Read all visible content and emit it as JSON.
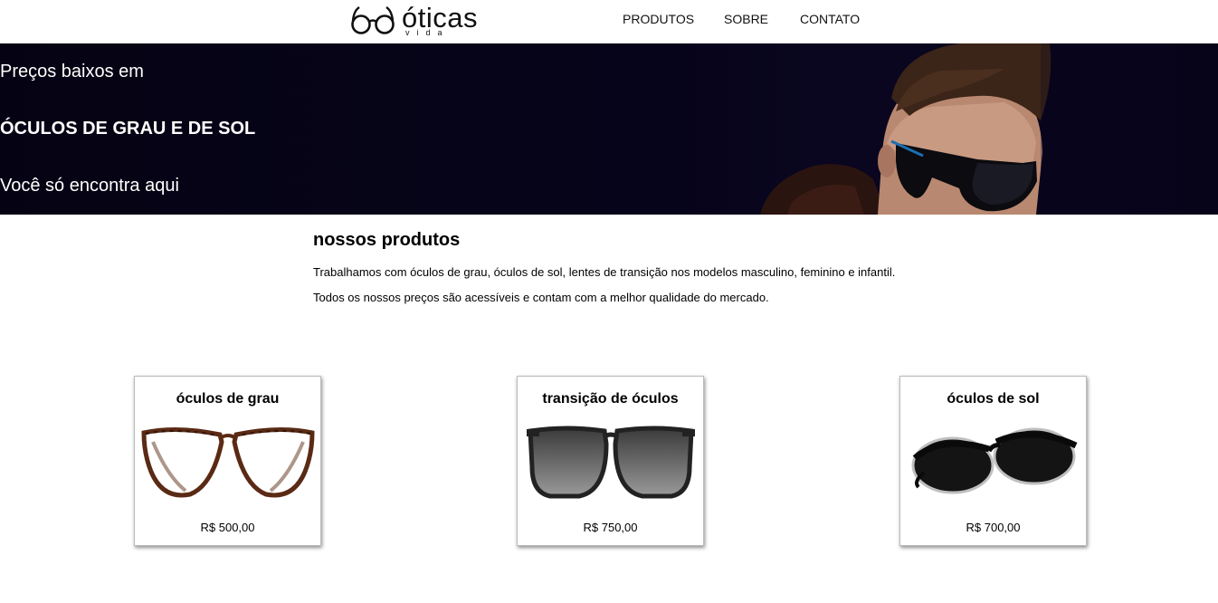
{
  "brand": {
    "name": "óticas",
    "sub": "vida"
  },
  "nav": {
    "items": [
      "PRODUTOS",
      "SOBRE",
      "CONTATO"
    ]
  },
  "hero": {
    "line1": "Preços baixos em",
    "line2": "ÓCULOS DE GRAU E DE SOL",
    "line3": "Você só encontra aqui"
  },
  "products_section": {
    "title": "nossos produtos",
    "paragraph1": "Trabalhamos com óculos de grau, óculos de sol, lentes de transição nos modelos masculino, feminino e infantil.",
    "paragraph2": "Todos os nossos preços são acessíveis e contam com a melhor qualidade do mercado."
  },
  "products": [
    {
      "title": "óculos de grau",
      "price": "R$ 500,00"
    },
    {
      "title": "transição de óculos",
      "price": "R$ 750,00"
    },
    {
      "title": "óculos de sol",
      "price": "R$ 700,00"
    }
  ],
  "colors": {
    "hero_bg": "#06041a",
    "hero_text": "#ffffff",
    "text": "#000000"
  }
}
